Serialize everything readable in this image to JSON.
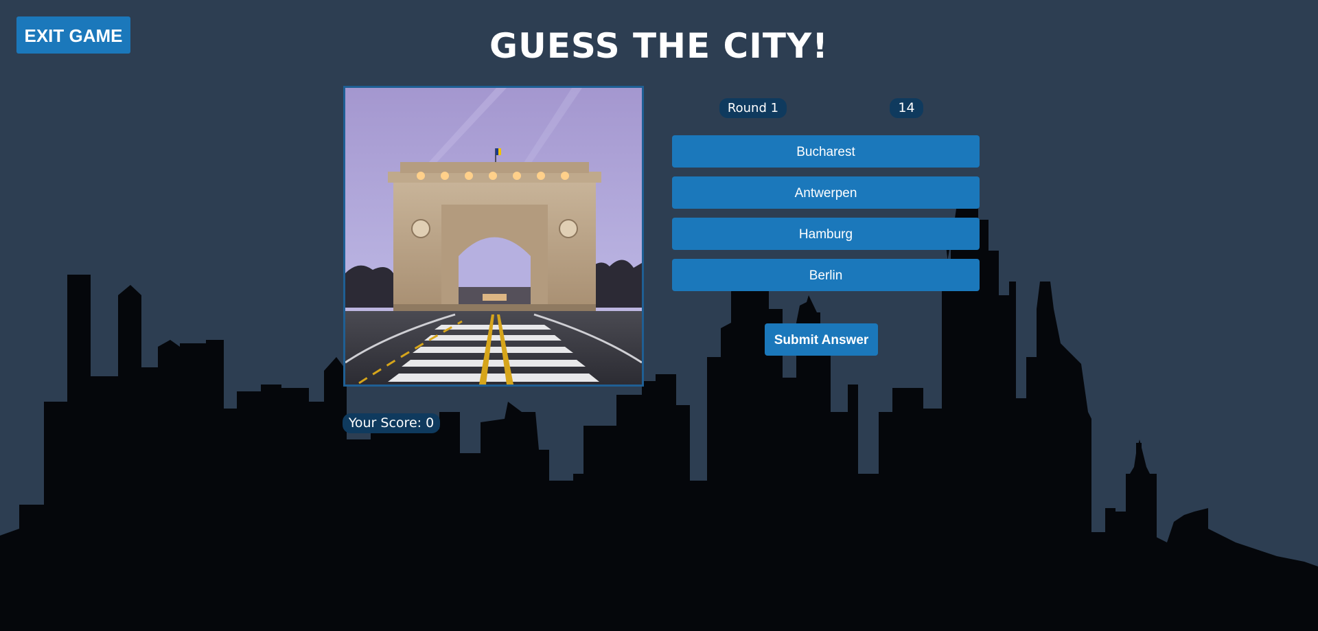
{
  "app": {
    "title": "GUESS THE CITY!",
    "exit_label": "EXIT GAME"
  },
  "game": {
    "round_label": "Round 1",
    "timer_value": "14",
    "score_label": "Your Score: 0",
    "photo_subject": "triumphal-arch-photo",
    "options": [
      {
        "label": "Bucharest"
      },
      {
        "label": "Antwerpen"
      },
      {
        "label": "Hamburg"
      },
      {
        "label": "Berlin"
      }
    ],
    "submit_label": "Submit Answer"
  },
  "colors": {
    "background": "#2d3e52",
    "skyline": "#05070b",
    "button": "#1b78bb",
    "pill": "#0f3a5e",
    "photo_border": "#1f5f94",
    "text": "#ffffff"
  }
}
